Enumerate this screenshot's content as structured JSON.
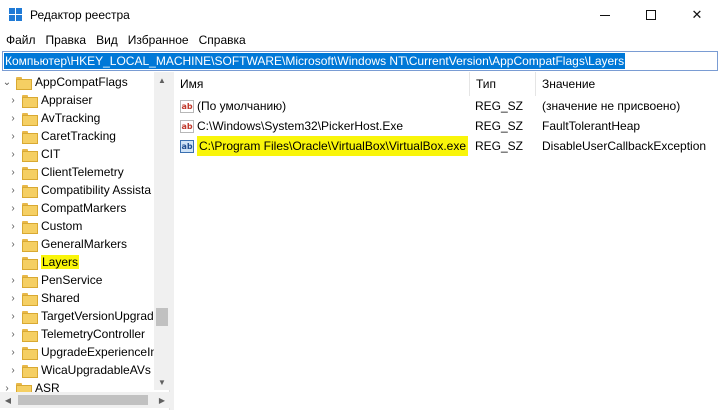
{
  "window": {
    "title": "Редактор реестра",
    "minimize_glyph": "—",
    "close_glyph": "✕"
  },
  "menu": [
    "Файл",
    "Правка",
    "Вид",
    "Избранное",
    "Справка"
  ],
  "address": {
    "path": "Компьютер\\HKEY_LOCAL_MACHINE\\SOFTWARE\\Microsoft\\Windows NT\\CurrentVersion\\AppCompatFlags\\Layers"
  },
  "tree": {
    "items": [
      {
        "label": "AppCompatFlags",
        "expander": "open"
      },
      {
        "label": "Appraiser",
        "expander": "closed"
      },
      {
        "label": "AvTracking",
        "expander": "closed"
      },
      {
        "label": "CaretTracking",
        "expander": "closed"
      },
      {
        "label": "CIT",
        "expander": "closed"
      },
      {
        "label": "ClientTelemetry",
        "expander": "closed"
      },
      {
        "label": "Compatibility Assista",
        "expander": "closed"
      },
      {
        "label": "CompatMarkers",
        "expander": "closed"
      },
      {
        "label": "Custom",
        "expander": "closed"
      },
      {
        "label": "GeneralMarkers",
        "expander": "closed"
      },
      {
        "label": "Layers",
        "expander": "none",
        "highlighted": true
      },
      {
        "label": "PenService",
        "expander": "closed"
      },
      {
        "label": "Shared",
        "expander": "closed"
      },
      {
        "label": "TargetVersionUpgrad",
        "expander": "closed"
      },
      {
        "label": "TelemetryController",
        "expander": "closed"
      },
      {
        "label": "UpgradeExperienceIn",
        "expander": "closed"
      },
      {
        "label": "WicaUpgradableAVs",
        "expander": "closed"
      },
      {
        "label": "ASR",
        "expander": "closed"
      }
    ]
  },
  "list": {
    "columns": {
      "name": "Имя",
      "type": "Тип",
      "value": "Значение"
    },
    "rows": [
      {
        "name": "(По умолчанию)",
        "type": "REG_SZ",
        "value": "(значение не присвоено)",
        "icon": "ab-string-icon"
      },
      {
        "name": "C:\\Windows\\System32\\PickerHost.Exe",
        "type": "REG_SZ",
        "value": "FaultTolerantHeap",
        "icon": "ab-string-icon"
      },
      {
        "name": "C:\\Program Files\\Oracle\\VirtualBox\\VirtualBox.exe",
        "type": "REG_SZ",
        "value": "DisableUserCallbackException",
        "icon": "ab-string-icon",
        "selected": true
      }
    ]
  },
  "colors": {
    "accent": "#0078d7",
    "highlight": "#f9f50a",
    "folder": "#f5cf63"
  }
}
